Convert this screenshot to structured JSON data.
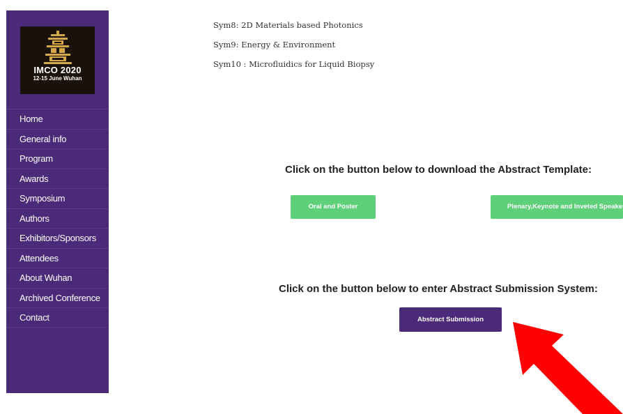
{
  "sidebar": {
    "logo": {
      "title": "IMCO 2020",
      "subtitle": "12-15 June  Wuhan"
    },
    "nav": [
      {
        "label": "Home"
      },
      {
        "label": "General info"
      },
      {
        "label": "Program"
      },
      {
        "label": "Awards"
      },
      {
        "label": "Symposium"
      },
      {
        "label": "Authors"
      },
      {
        "label": "Exhibitors/Sponsors"
      },
      {
        "label": "Attendees"
      },
      {
        "label": "About Wuhan"
      },
      {
        "label": "Archived Conference"
      },
      {
        "label": "Contact"
      }
    ]
  },
  "main": {
    "symposia": [
      "Sym8: 2D Materials based Photonics",
      "Sym9: Energy & Environment",
      "Sym10 : Microfluidics for Liquid Biopsy"
    ],
    "template_heading": "Click on the button below to download the Abstract Template:",
    "buttons": {
      "oral_poster": "Oral and Poster",
      "plenary": "Plenary,Keynote and Inveted Speakers"
    },
    "submission_heading": "Click on the button below to enter Abstract Submission System:",
    "abstract_submission": "Abstract Submission"
  },
  "colors": {
    "sidebar_bg": "#4a2a79",
    "green_button": "#5fd07a",
    "purple_button": "#4a2a79",
    "arrow": "#ff0000"
  },
  "icons": {
    "logo_emblem": "gold-tower-emblem-icon",
    "annotation": "red-arrow-icon"
  }
}
